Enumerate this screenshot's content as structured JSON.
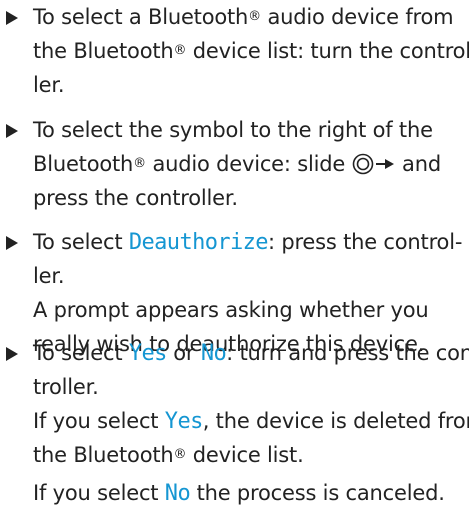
{
  "steps": [
    {
      "lines": [
        [
          "To select a Bluetooth",
          {
            "sup": "®"
          },
          " audio device from"
        ],
        [
          "the Bluetooth",
          {
            "sup": "®"
          },
          " device list: turn the control-"
        ],
        [
          "ler."
        ]
      ]
    },
    {
      "lines": [
        [
          "To select the symbol to the right of the"
        ],
        [
          "Bluetooth",
          {
            "sup": "®"
          },
          " audio device: slide ",
          {
            "icon": "controller-slide-right-icon"
          },
          " and"
        ],
        [
          "press the controller."
        ]
      ]
    },
    {
      "lines": [
        [
          "To select ",
          {
            "hl": "Deauthorize"
          },
          ": press the control-"
        ],
        [
          "ler."
        ],
        [
          "A prompt appears asking whether you"
        ],
        [
          "really wish to deauthorize this device."
        ]
      ]
    },
    {
      "lines": [
        [
          "To select ",
          {
            "hl": "Yes"
          },
          " or ",
          {
            "hl": "No"
          },
          ": turn and press the con-"
        ],
        [
          "troller."
        ],
        [
          "If you select ",
          {
            "hl": "Yes"
          },
          ", the device is deleted from"
        ],
        [
          "the Bluetooth",
          {
            "sup": "®"
          },
          " device list."
        ],
        {
          "gap": 4
        },
        [
          "If you select ",
          {
            "hl": "No"
          },
          " the process is canceled."
        ]
      ]
    }
  ]
}
